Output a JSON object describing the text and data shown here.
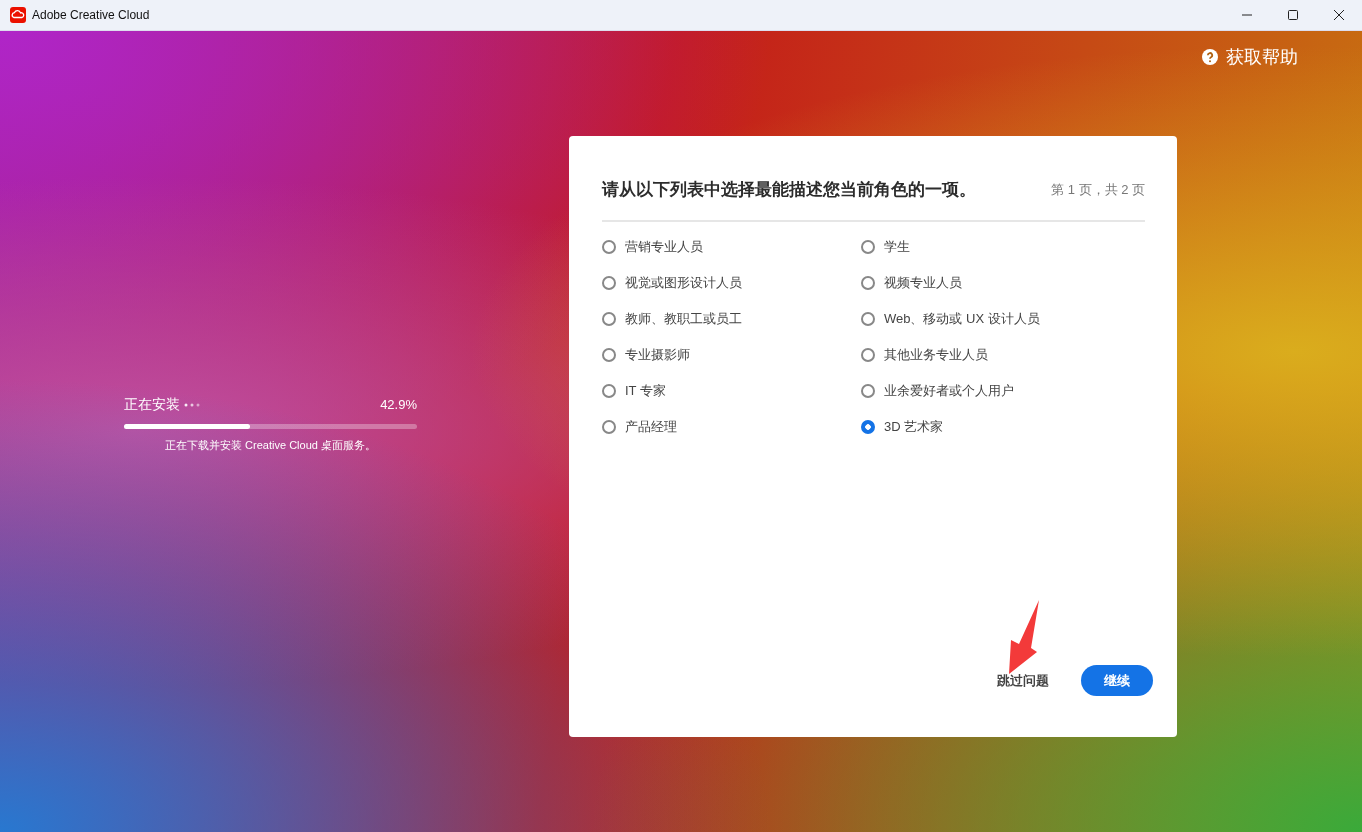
{
  "window": {
    "title": "Adobe Creative Cloud"
  },
  "help_link": {
    "label": "获取帮助"
  },
  "install": {
    "status": "正在安装",
    "percent": "42.9%",
    "level": 0.429,
    "message": "正在下载并安装 Creative Cloud 桌面服务。"
  },
  "dialog": {
    "question": "请从以下列表中选择最能描述您当前角色的一项。",
    "page_indicator": "第 1 页，共 2 页",
    "options": [
      {
        "label": "营销专业人员",
        "selected": false
      },
      {
        "label": "学生",
        "selected": false
      },
      {
        "label": "视觉或图形设计人员",
        "selected": false
      },
      {
        "label": "视频专业人员",
        "selected": false
      },
      {
        "label": "教师、教职工或员工",
        "selected": false
      },
      {
        "label": "Web、移动或 UX 设计人员",
        "selected": false
      },
      {
        "label": "专业摄影师",
        "selected": false
      },
      {
        "label": "其他业务专业人员",
        "selected": false
      },
      {
        "label": "IT 专家",
        "selected": false
      },
      {
        "label": "业余爱好者或个人用户",
        "selected": false
      },
      {
        "label": "产品经理",
        "selected": false
      },
      {
        "label": "3D 艺术家",
        "selected": true
      }
    ],
    "skip_button": "跳过问题",
    "continue_button": "继续"
  }
}
